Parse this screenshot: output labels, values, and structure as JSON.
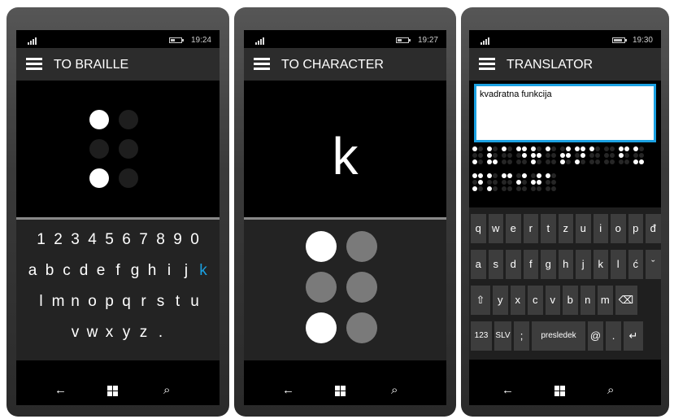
{
  "screens": [
    {
      "title": "TO BRAILLE",
      "time": "19:24",
      "braille": [
        true,
        false,
        false,
        false,
        true,
        false
      ],
      "keyboard_rows": [
        [
          "1",
          "2",
          "3",
          "4",
          "5",
          "6",
          "7",
          "8",
          "9",
          "0"
        ],
        [
          "a",
          "b",
          "c",
          "d",
          "e",
          "f",
          "g",
          "h",
          "i",
          "j",
          "k"
        ],
        [
          "l",
          "m",
          "n",
          "o",
          "p",
          "q",
          "r",
          "s",
          "t",
          "u"
        ],
        [
          "v",
          "w",
          "x",
          "y",
          "z",
          "."
        ]
      ],
      "selected_key": "k"
    },
    {
      "title": "TO CHARACTER",
      "time": "19:27",
      "character": "k",
      "braille": [
        true,
        false,
        false,
        false,
        true,
        false
      ]
    },
    {
      "title": "TRANSLATOR",
      "time": "19:30",
      "input_text": "kvadratna funkcija",
      "keys_row1": [
        "q",
        "w",
        "e",
        "r",
        "t",
        "z",
        "u",
        "i",
        "o",
        "p",
        "đ"
      ],
      "keys_row2": [
        "a",
        "s",
        "d",
        "f",
        "g",
        "h",
        "j",
        "k",
        "l",
        "ć",
        "ˇ"
      ],
      "keys_row3": [
        "⇧",
        "y",
        "x",
        "c",
        "v",
        "b",
        "n",
        "m",
        "⌫"
      ],
      "keys_row4": [
        "123",
        "SLV",
        ";",
        "presledek",
        "@",
        ".",
        "↵"
      ]
    }
  ],
  "nav": {
    "back": "←",
    "search": "⌕"
  },
  "colors": {
    "accent": "#1ba1e2",
    "appbar": "#2c2c2c",
    "dot_on": "#ffffff",
    "dot_off_dark": "#1e1e1e",
    "dot_off_grey": "#7a7a7a",
    "keypad": "#232323"
  }
}
